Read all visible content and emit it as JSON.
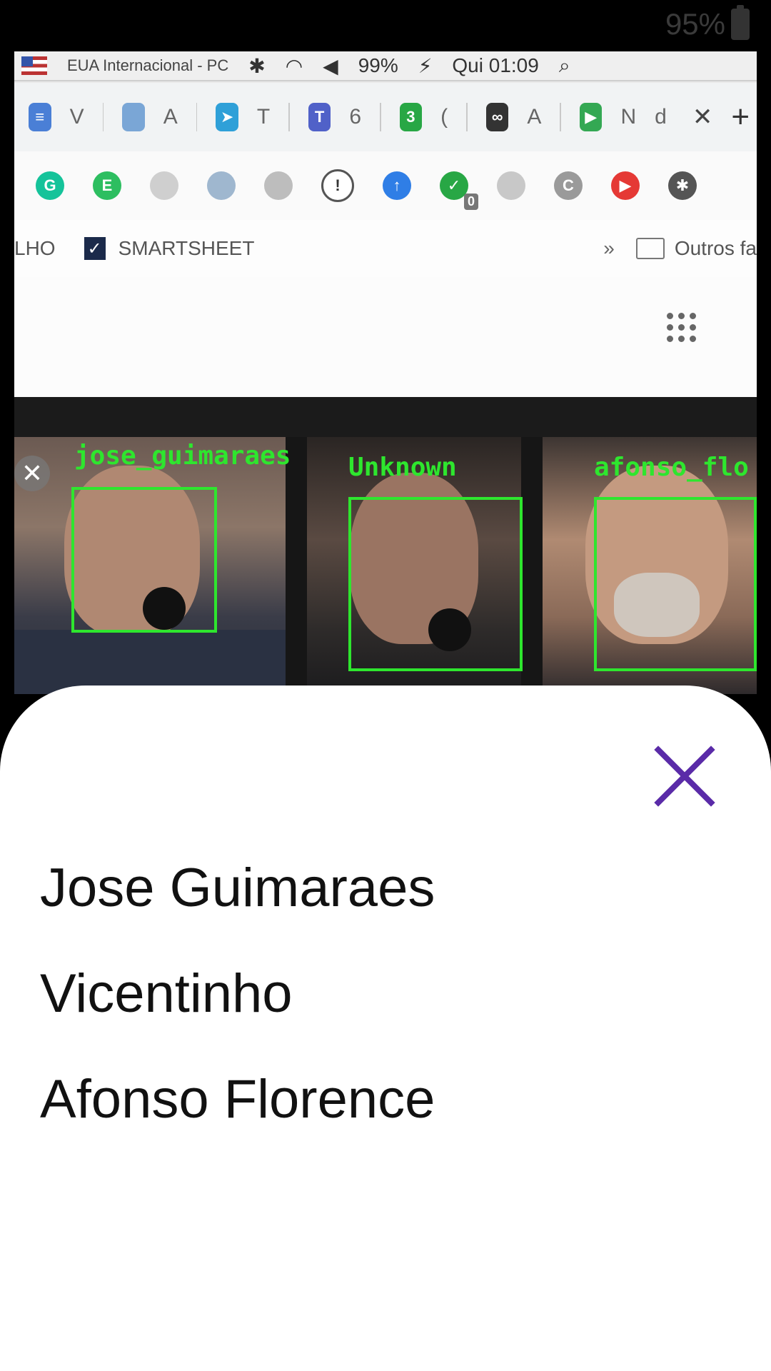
{
  "status_bar": {
    "battery": "95%"
  },
  "camera_preview": {
    "taskbar": {
      "keyboard_label": "EUA Internacional - PC",
      "battery": "99%",
      "clock": "Qui 01:09"
    },
    "tabs": [
      {
        "label": "V",
        "color": "#4a7fd6",
        "glyph": "≡"
      },
      {
        "label": "A",
        "color": "#7aa6d6",
        "glyph": ""
      },
      {
        "label": "T",
        "color": "#2fa0d8",
        "glyph": "➤"
      },
      {
        "label": "6",
        "color": "#5061c8",
        "glyph": "T"
      },
      {
        "label": "(",
        "color": "#28a745",
        "glyph": "3"
      },
      {
        "label": "A",
        "color": "#333333",
        "glyph": "∞"
      },
      {
        "label": "N",
        "color": "#34a853",
        "glyph": "▶"
      }
    ],
    "active_tab_label": "d",
    "extensions": [
      {
        "name": "grammarly-icon",
        "color": "#15c39a",
        "glyph": "G"
      },
      {
        "name": "evernote-icon",
        "color": "#2dbe60",
        "glyph": "E"
      },
      {
        "name": "document-icon",
        "color": "#cfcfcf",
        "glyph": ""
      },
      {
        "name": "owl-extension-icon",
        "color": "#9fb7cf",
        "glyph": ""
      },
      {
        "name": "box-icon",
        "color": "#bdbdbd",
        "glyph": ""
      },
      {
        "name": "info-icon",
        "color": "#ffffff",
        "glyph": "!"
      },
      {
        "name": "arrow-up-icon",
        "color": "#2f7ee6",
        "glyph": "↑"
      },
      {
        "name": "shield-check-icon",
        "color": "#28a745",
        "glyph": "✓"
      },
      {
        "name": "puzzle-small-icon",
        "color": "#c8c8c8",
        "glyph": ""
      },
      {
        "name": "c-extension-icon",
        "color": "#9a9a9a",
        "glyph": "C"
      },
      {
        "name": "youtube-icon",
        "color": "#e53935",
        "glyph": "▶"
      },
      {
        "name": "extensions-puzzle-icon",
        "color": "#555555",
        "glyph": "✱"
      }
    ],
    "extension_badge": "0",
    "bookmarks": {
      "left_partial": "LHO",
      "smartsheet": "SMARTSHEET",
      "overflow": "»",
      "other_folder": "Outros fa"
    },
    "detections": [
      {
        "label": "jose_guimaraes"
      },
      {
        "label": "Unknown"
      },
      {
        "label": "afonso_flo"
      }
    ],
    "dismiss_glyph": "✕"
  },
  "results_sheet": {
    "names": [
      "Jose Guimaraes",
      "Vicentinho",
      "Afonso Florence"
    ],
    "close_color": "#5a2ba8"
  }
}
